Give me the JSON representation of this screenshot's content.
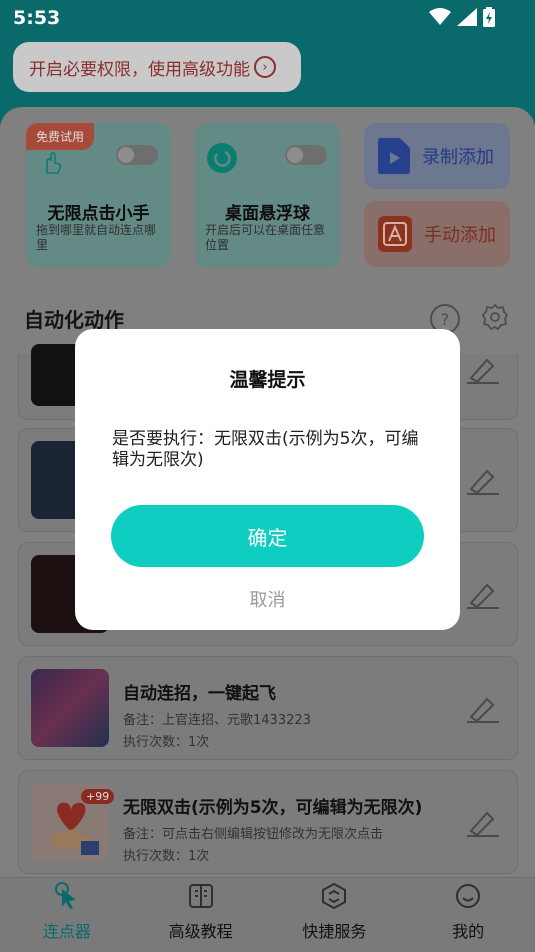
{
  "status": {
    "time": "5:53"
  },
  "header": {
    "permission_btn": "开启必要权限，使用高级功能"
  },
  "cards": {
    "clicker": {
      "badge": "免费试用",
      "title": "无限点击小手",
      "desc": "拖到哪里就自动连点哪里"
    },
    "float": {
      "title": "桌面悬浮球",
      "desc": "开启后可以在桌面任意位置"
    },
    "record": {
      "label": "录制添加"
    },
    "manual": {
      "label": "手动添加"
    }
  },
  "section": {
    "title": "自动化动作"
  },
  "list": [
    {
      "title": "自动连招，一键起飞",
      "note": "备注：上官连招、元歌1433223",
      "count": "执行次数：1次"
    },
    {
      "title": "无限双击(示例为5次，可编辑为无限次)",
      "note": "备注：可点击右侧编辑按钮修改为无限次点击",
      "count": "执行次数：1次",
      "badge": "+99"
    }
  ],
  "nav": [
    {
      "label": "连点器"
    },
    {
      "label": "高级教程"
    },
    {
      "label": "快捷服务"
    },
    {
      "label": "我的"
    }
  ],
  "dialog": {
    "title": "温馨提示",
    "message": "是否要执行：无限双击(示例为5次，可编辑为无限次)",
    "ok": "确定",
    "cancel": "取消"
  },
  "colors": {
    "accent": "#0dcec0",
    "header": "#0a6a6b",
    "nav_active": "#0a6a6b"
  }
}
